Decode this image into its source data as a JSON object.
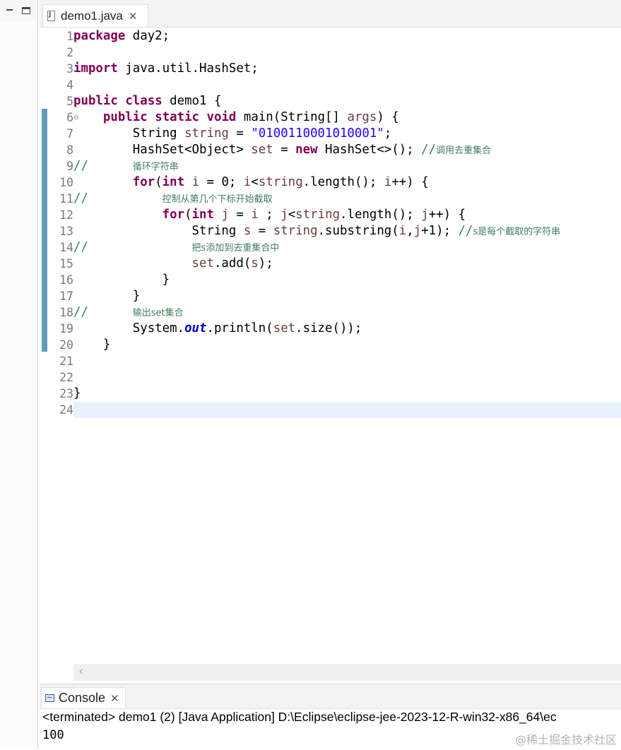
{
  "editor": {
    "tab_label": "demo1.java",
    "tab_close": "✕",
    "current_line": 24,
    "line_numbers": [
      "1",
      "2",
      "3",
      "4",
      "5",
      "6",
      "7",
      "8",
      "9",
      "10",
      "11",
      "12",
      "13",
      "14",
      "15",
      "16",
      "17",
      "18",
      "19",
      "20",
      "21",
      "22",
      "23",
      "24"
    ],
    "code": {
      "l1_kw": "package",
      "l1_rest": " day2;",
      "l3_kw": "import",
      "l3_rest": " java.util.HashSet;",
      "l5_kw1": "public",
      "l5_kw2": "class",
      "l5_rest": " demo1 {",
      "l6_kw1": "public",
      "l6_kw2": "static",
      "l6_kw3": "void",
      "l6_mid": " main(String[] ",
      "l6_var": "args",
      "l6_end": ") {",
      "l7_type": "String ",
      "l7_var": "string",
      "l7_eq": " = ",
      "l7_str": "\"0100110001010001\"",
      "l7_end": ";",
      "l8_type": "HashSet<Object> ",
      "l8_var": "set",
      "l8_eq": " = ",
      "l8_kw": "new",
      "l8_rest": " HashSet<>(); ",
      "l8_cmt": "//",
      "l8_cmt_text": "调用去重集合",
      "l9_cmt": "//",
      "l9_cmt_text": "循环字符串",
      "l10_kw1": "for",
      "l10_p": "(",
      "l10_kw2": "int",
      "l10_var1": " i",
      "l10_mid1": " = 0; ",
      "l10_var2": "i",
      "l10_mid2": "<",
      "l10_var3": "string",
      "l10_mid3": ".length(); ",
      "l10_var4": "i",
      "l10_end": "++) {",
      "l11_cmt": "//",
      "l11_cmt_text": "控制从第几个下标开始截取",
      "l12_kw1": "for",
      "l12_p": "(",
      "l12_kw2": "int",
      "l12_var1": " j",
      "l12_mid1": " = ",
      "l12_var2": "i",
      "l12_mid2": " ; ",
      "l12_var3": "j",
      "l12_mid3": "<",
      "l12_var4": "string",
      "l12_mid4": ".length(); ",
      "l12_var5": "j",
      "l12_end": "++) {",
      "l13_type": "String ",
      "l13_var1": "s",
      "l13_eq": " = ",
      "l13_var2": "string",
      "l13_mid": ".substring(",
      "l13_var3": "i",
      "l13_comma": ",",
      "l13_var4": "j",
      "l13_end": "+1); ",
      "l13_cmt": "//",
      "l13_cmt_text": "s是每个截取的字符串",
      "l14_cmt": "//",
      "l14_cmt_text": "把s添加到去重集合中",
      "l15_var": "set",
      "l15_mid": ".add(",
      "l15_var2": "s",
      "l15_end": ");",
      "l16": "}",
      "l17": "}",
      "l18_cmt": "//",
      "l18_cmt_text": "输出set集合",
      "l19_a": "System.",
      "l19_field": "out",
      "l19_b": ".println(",
      "l19_var": "set",
      "l19_c": ".size());",
      "l20": "}",
      "l23": "}"
    }
  },
  "console": {
    "tab_label": "Console",
    "tab_close": "✕",
    "status": "<terminated> demo1 (2) [Java Application] D:\\Eclipse\\eclipse-jee-2023-12-R-win32-x86_64\\ec",
    "output": "100"
  },
  "watermark": "@稀土掘金技术社区",
  "colors": {
    "keyword": "#7f0055",
    "string": "#2a00ff",
    "comment": "#3f7f5f",
    "local_variable": "#6a3e3e",
    "static_field": "#0000c0",
    "current_line_highlight": "#e8f2fe",
    "change_ruler": "#5e9eb5"
  }
}
